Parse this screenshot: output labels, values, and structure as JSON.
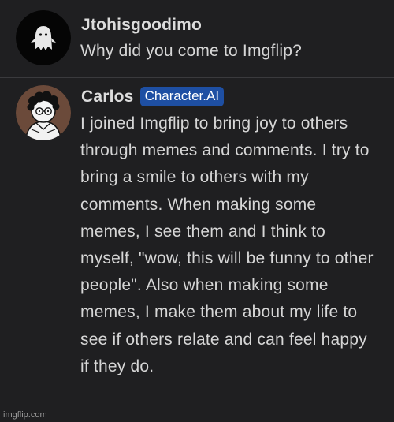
{
  "messages": [
    {
      "author": "Jtohisgoodimo",
      "avatar_icon": "ghost-icon",
      "text": "Why did you come to Imgflip?"
    },
    {
      "author": "Carlos",
      "badge": "Character.AI",
      "avatar_icon": "cartoon-character-avatar",
      "text": "I joined Imgflip to bring joy to others through memes and comments. I try to bring a smile to others with my comments. When making some memes, I see them and I think to myself, \"wow, this will be funny to other people\". Also when making some memes, I make them about my life to see if others relate and can feel happy if they do."
    }
  ],
  "watermark": "imgflip.com",
  "colors": {
    "background": "#1f1f21",
    "badge": "#1e4fa3",
    "divider": "#3a3a3d",
    "text": "#d6d6d6"
  }
}
